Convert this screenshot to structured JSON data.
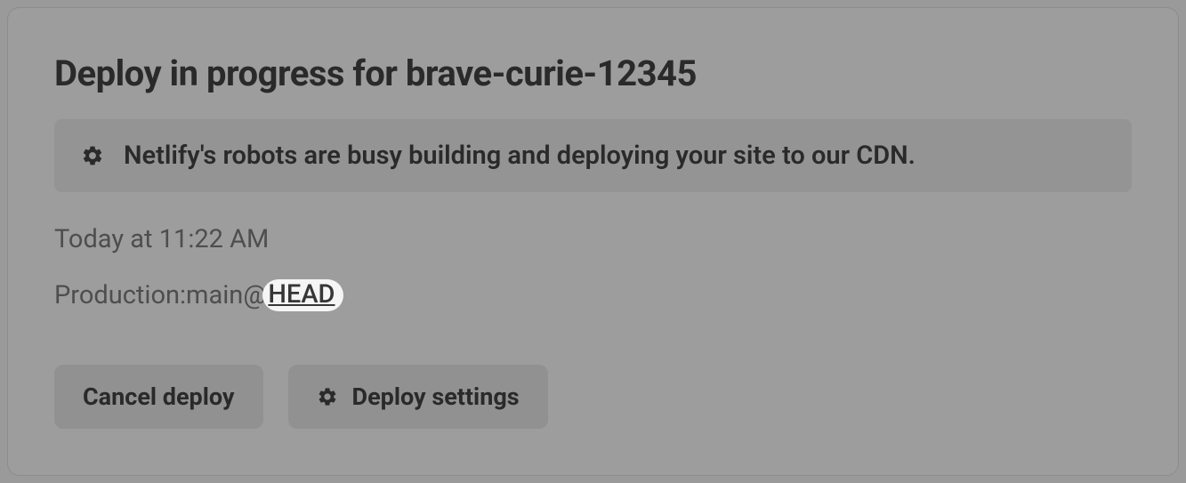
{
  "card": {
    "title_prefix": "Deploy in progress for ",
    "site_name": "brave-curie-12345",
    "status_message": "Netlify's robots are busy building and deploying your site to our CDN.",
    "timestamp": "Today at 11:22 AM",
    "production_prefix": "Production: ",
    "branch": "main",
    "at": "@",
    "ref": "HEAD"
  },
  "buttons": {
    "cancel": "Cancel deploy",
    "settings": "Deploy settings"
  }
}
